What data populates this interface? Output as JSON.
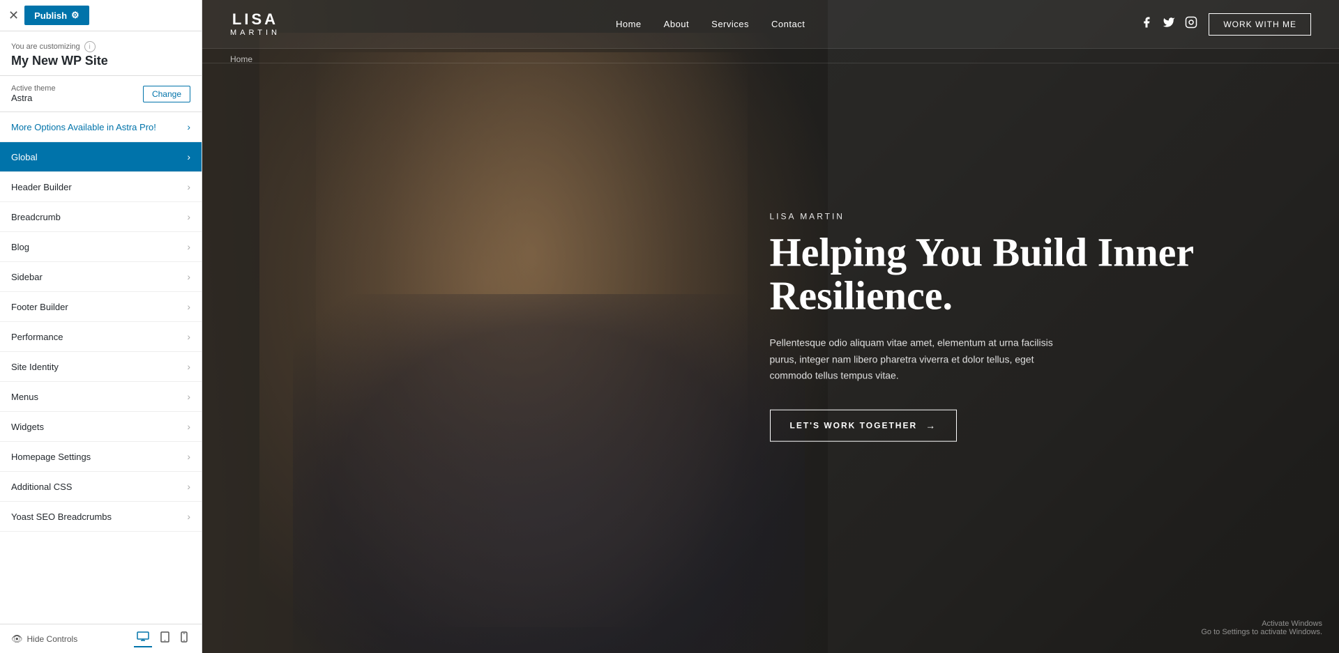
{
  "panel": {
    "close_label": "✕",
    "publish_label": "Publish",
    "gear_label": "⚙",
    "customizing_label": "You are customizing",
    "info_icon": "i",
    "site_name": "My New WP Site",
    "active_theme_label": "Active theme",
    "active_theme_name": "Astra",
    "change_btn": "Change",
    "menu_items": [
      {
        "id": "astra-pro",
        "label": "More Options Available in Astra Pro!",
        "highlight": "astra-pro"
      },
      {
        "id": "global",
        "label": "Global",
        "highlight": "active"
      },
      {
        "id": "header-builder",
        "label": "Header Builder",
        "highlight": ""
      },
      {
        "id": "breadcrumb",
        "label": "Breadcrumb",
        "highlight": ""
      },
      {
        "id": "blog",
        "label": "Blog",
        "highlight": ""
      },
      {
        "id": "sidebar",
        "label": "Sidebar",
        "highlight": ""
      },
      {
        "id": "footer-builder",
        "label": "Footer Builder",
        "highlight": ""
      },
      {
        "id": "performance",
        "label": "Performance",
        "highlight": ""
      },
      {
        "id": "site-identity",
        "label": "Site Identity",
        "highlight": ""
      },
      {
        "id": "menus",
        "label": "Menus",
        "highlight": ""
      },
      {
        "id": "widgets",
        "label": "Widgets",
        "highlight": ""
      },
      {
        "id": "homepage-settings",
        "label": "Homepage Settings",
        "highlight": ""
      },
      {
        "id": "additional-css",
        "label": "Additional CSS",
        "highlight": ""
      },
      {
        "id": "yoast-seo",
        "label": "Yoast SEO Breadcrumbs",
        "highlight": ""
      }
    ],
    "hide_controls_label": "Hide Controls",
    "device_desktop": "🖥",
    "device_tablet": "⬜",
    "device_mobile": "📱"
  },
  "site": {
    "logo_first": "LISA",
    "logo_last": "MARTIN",
    "nav": [
      {
        "id": "home",
        "label": "Home"
      },
      {
        "id": "about",
        "label": "About"
      },
      {
        "id": "services",
        "label": "Services"
      },
      {
        "id": "contact",
        "label": "Contact"
      }
    ],
    "social": {
      "facebook": "f",
      "twitter": "t",
      "instagram": "in"
    },
    "work_with_me_btn": "WORK WITH ME",
    "breadcrumb": "Home",
    "hero": {
      "subtitle": "LISA MARTIN",
      "title": "Helping You Build Inner Resilience.",
      "description": "Pellentesque odio aliquam vitae amet, elementum at urna facilisis purus, integer nam libero pharetra viverra et dolor tellus, eget commodo tellus tempus vitae.",
      "cta_label": "LET'S WORK TOGETHER",
      "cta_arrow": "→"
    },
    "activate_windows_line1": "Activate Windows",
    "activate_windows_line2": "Go to Settings to activate Windows."
  }
}
